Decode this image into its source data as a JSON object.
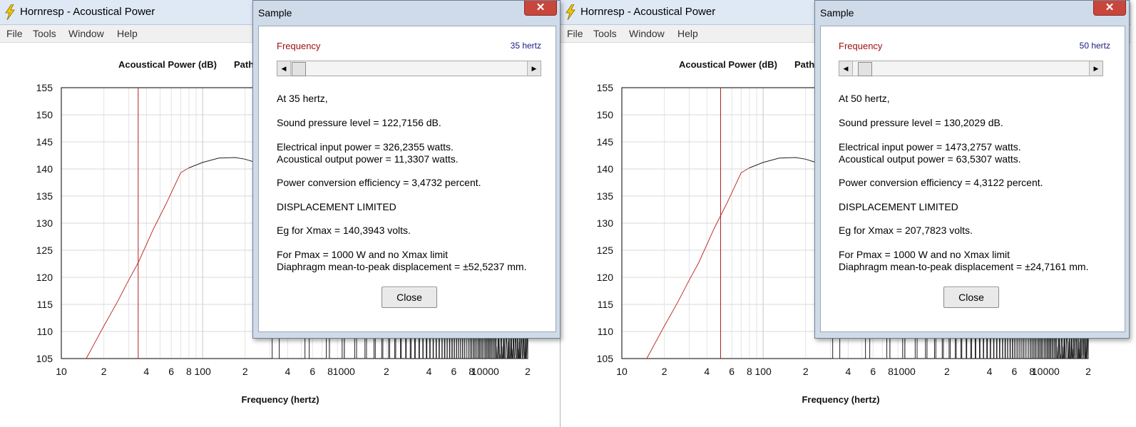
{
  "colors": {
    "title_bar": "#dfe9f5",
    "dialog_frame": "#cfdbe9",
    "frequency_accent": "#a01010",
    "marker_line": "#b02020",
    "curve": "#222222"
  },
  "windows": [
    {
      "app": {
        "title": "Hornresp - Acoustical Power",
        "menu": [
          "File",
          "Tools",
          "Window",
          "Help"
        ],
        "chart_title": "Acoustical Power (dB)",
        "chart_title_cut": "Path"
      },
      "dialog": {
        "title": "Sample",
        "close_glyph": "✕",
        "frequency_label": "Frequency",
        "frequency_value": "35 hertz",
        "slider_fraction": 0.005,
        "lines": [
          "At 35 hertz,",
          "Sound pressure level = 122,7156 dB.",
          "Electrical input power = 326,2355 watts.",
          "Acoustical output power = 11,3307 watts.",
          "Power conversion efficiency = 3,4732 percent.",
          "DISPLACEMENT LIMITED",
          "Eg for Xmax = 140,3943 volts.",
          "For Pmax = 1000 W and no Xmax limit",
          "Diaphragm mean-to-peak displacement = ±52,5237 mm."
        ],
        "close_label": "Close"
      }
    },
    {
      "app": {
        "title": "Hornresp - Acoustical Power",
        "menu": [
          "File",
          "Tools",
          "Window",
          "Help"
        ],
        "chart_title": "Acoustical Power (dB)",
        "chart_title_cut": "Path"
      },
      "dialog": {
        "title": "Sample",
        "close_glyph": "✕",
        "frequency_label": "Frequency",
        "frequency_value": "50 hertz",
        "slider_fraction": 0.025,
        "lines": [
          "At 50 hertz,",
          "Sound pressure level = 130,2029 dB.",
          "Electrical input power = 1473,2757 watts.",
          "Acoustical output power = 63,5307 watts.",
          "Power conversion efficiency = 4,3122 percent.",
          "DISPLACEMENT LIMITED",
          "Eg for Xmax = 207,7823 volts.",
          "For Pmax = 1000 W and no Xmax limit",
          "Diaphragm mean-to-peak displacement = ±24,7161 mm."
        ],
        "close_label": "Close"
      }
    }
  ],
  "chart_data": [
    {
      "type": "line",
      "title": "Acoustical Power (dB)",
      "xlabel": "Frequency (hertz)",
      "ylabel": "",
      "xscale": "log",
      "xlim": [
        10,
        20000
      ],
      "ylim": [
        105,
        155
      ],
      "y_ticks": [
        "155",
        "150",
        "145",
        "140",
        "135",
        "130",
        "125",
        "120",
        "115",
        "110",
        "105"
      ],
      "x_ticks": [
        "10",
        "2",
        "4",
        "6",
        "8",
        "100",
        "2",
        "4",
        "6",
        "8",
        "1000",
        "2",
        "4",
        "6",
        "8",
        "10000",
        "2"
      ],
      "grid": true,
      "marker_frequency": 35,
      "series": [
        {
          "x": [
            15,
            20,
            25,
            30,
            35,
            45,
            55,
            70,
            80,
            100,
            130,
            170,
            200,
            250,
            300,
            340
          ],
          "y": [
            105,
            111,
            115.5,
            119.5,
            122.7,
            129,
            133.5,
            139.3,
            140.2,
            141.2,
            142.0,
            142.1,
            141.8,
            141.0,
            140.0,
            139.3
          ]
        }
      ],
      "ripple_start_hz": 300
    },
    {
      "type": "line",
      "title": "Acoustical Power (dB)",
      "xlabel": "Frequency (hertz)",
      "ylabel": "",
      "xscale": "log",
      "xlim": [
        10,
        20000
      ],
      "ylim": [
        105,
        155
      ],
      "y_ticks": [
        "155",
        "150",
        "145",
        "140",
        "135",
        "130",
        "125",
        "120",
        "115",
        "110",
        "105"
      ],
      "x_ticks": [
        "10",
        "2",
        "4",
        "6",
        "8",
        "100",
        "2",
        "4",
        "6",
        "8",
        "1000",
        "2",
        "4",
        "6",
        "8",
        "10000",
        "2"
      ],
      "grid": true,
      "marker_frequency": 50,
      "series": [
        {
          "x": [
            15,
            20,
            25,
            30,
            35,
            45,
            55,
            70,
            80,
            100,
            130,
            170,
            200,
            250,
            300,
            340
          ],
          "y": [
            105,
            111,
            115.5,
            119.5,
            122.7,
            129,
            133.5,
            139.3,
            140.2,
            141.2,
            142.0,
            142.1,
            141.8,
            141.0,
            140.0,
            139.3
          ]
        }
      ],
      "ripple_start_hz": 300
    }
  ]
}
